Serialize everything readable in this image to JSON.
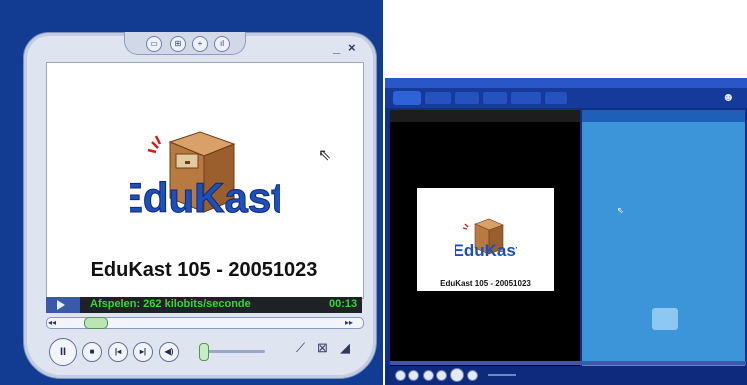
{
  "compact_player": {
    "top_icons": [
      "playlist-icon",
      "settings-icon",
      "add-icon",
      "chart-icon"
    ],
    "window_controls": {
      "minimize": "_",
      "close": "×"
    },
    "logo_text": "EduKast",
    "video_title": "EduKast 105 - 20051023",
    "status_text": "Afspelen: 262 kilobits/seconde",
    "time": "00:13",
    "seek_left": "◂◂",
    "seek_right": "▸▸",
    "controls": {
      "pause": "II",
      "stop": "■",
      "previous": "|◂",
      "next": "▸|",
      "mute": "◀)"
    }
  },
  "full_player": {
    "video_title": "EduKast 105 - 20051023",
    "logo_text": "EduKast"
  },
  "colors": {
    "skin_blue": "#123c92",
    "status_green": "#35d635",
    "list_blue": "#3b95d8"
  }
}
